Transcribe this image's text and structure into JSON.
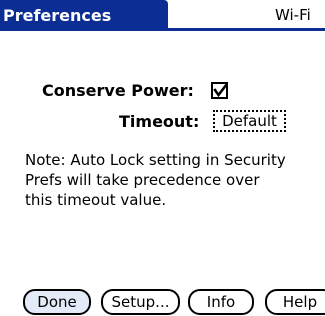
{
  "header": {
    "title": "Preferences",
    "category": "Wi-Fi"
  },
  "conserve_power": {
    "label": "Conserve Power:",
    "checked": true
  },
  "timeout": {
    "label": "Timeout:",
    "value": "Default"
  },
  "note": "Note: Auto Lock setting in Security\nPrefs will take precedence over\nthis timeout value.",
  "buttons": {
    "done": "Done",
    "setup": "Setup...",
    "info": "Info",
    "help": "Help"
  },
  "colors": {
    "title_bar": "#0b2d94",
    "selected_button": "#e3eaf8"
  },
  "icons": {
    "checkbox": "checkmark-checkbox-icon"
  }
}
